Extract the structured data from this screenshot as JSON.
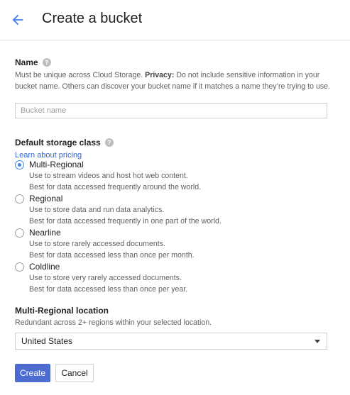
{
  "header": {
    "back_icon": "arrow-back-icon",
    "title": "Create a bucket",
    "accent": "#4285f4"
  },
  "name_section": {
    "label": "Name",
    "help_icon": "help-icon",
    "help_glyph": "?",
    "desc_before": "Must be unique across Cloud Storage. ",
    "privacy_label": "Privacy:",
    "desc_after": " Do not include sensitive information in your bucket name. Others can discover your bucket name if it matches a name they’re trying to use.",
    "input_value": "",
    "input_placeholder": "Bucket name"
  },
  "storage_class": {
    "label": "Default storage class",
    "help_icon": "help-icon",
    "help_glyph": "?",
    "pricing_link": "Learn about pricing",
    "selected": "Multi-Regional",
    "options": [
      {
        "title": "Multi-Regional",
        "line1": "Use to stream videos and host hot web content.",
        "line2": "Best for data accessed frequently around the world.",
        "selected": true
      },
      {
        "title": "Regional",
        "line1": "Use to store data and run data analytics.",
        "line2": "Best for data accessed frequently in one part of the world.",
        "selected": false
      },
      {
        "title": "Nearline",
        "line1": "Use to store rarely accessed documents.",
        "line2": "Best for data accessed less than once per month.",
        "selected": false
      },
      {
        "title": "Coldline",
        "line1": "Use to store very rarely accessed documents.",
        "line2": "Best for data accessed less than once per year.",
        "selected": false
      }
    ]
  },
  "location": {
    "label": "Multi-Regional location",
    "desc": "Redundant across 2+ regions within your selected location.",
    "selected_value": "United States",
    "dropdown_icon": "caret-down-icon"
  },
  "actions": {
    "create_label": "Create",
    "cancel_label": "Cancel",
    "primary_color": "#4e6cd0"
  }
}
